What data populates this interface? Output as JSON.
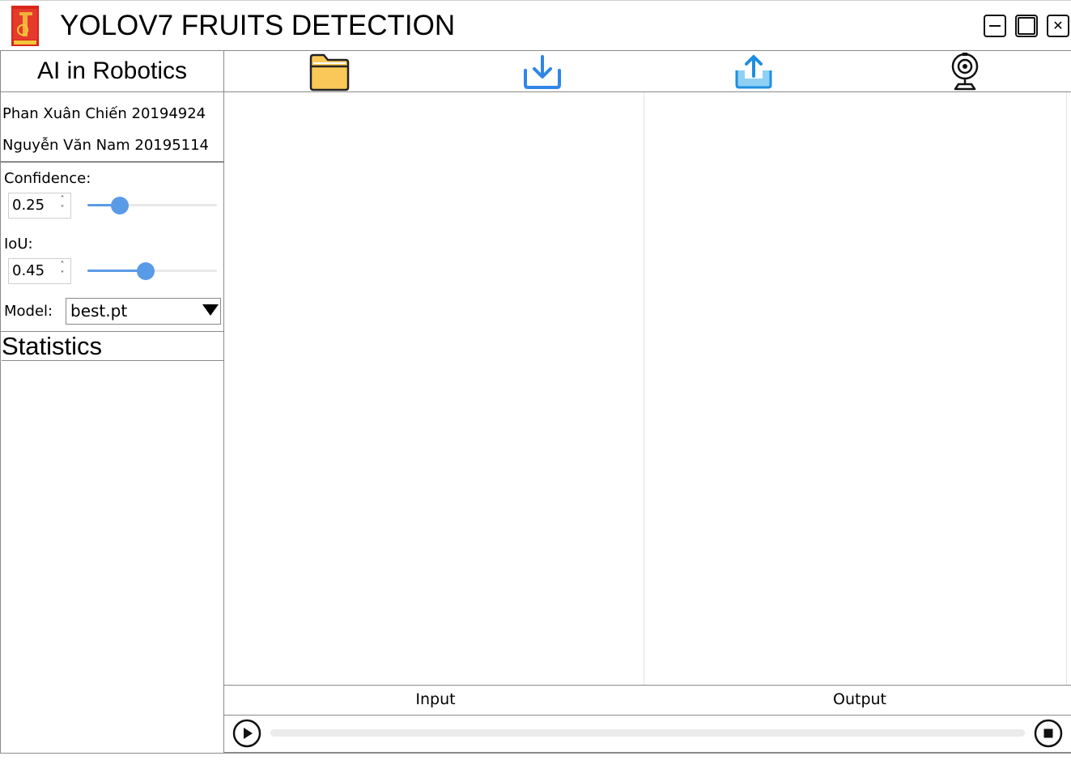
{
  "window": {
    "title": "YOLOV7 FRUITS DETECTION",
    "controls": {
      "minimize": "minimize-icon",
      "maximize": "maximize-icon",
      "close": "close-icon"
    }
  },
  "sidebar": {
    "course_title": "AI in Robotics",
    "members": [
      "Phan Xuân Chiến 20194924",
      "Nguyễn Văn Nam 20195114"
    ],
    "confidence": {
      "label": "Confidence:",
      "value": "0.25",
      "fraction": 0.25
    },
    "iou": {
      "label": "IoU:",
      "value": "0.45",
      "fraction": 0.45
    },
    "model": {
      "label": "Model:",
      "selected": "best.pt"
    },
    "statistics_title": "Statistics"
  },
  "toolbar": {
    "items": [
      "folder-icon",
      "download-icon",
      "upload-icon",
      "webcam-icon"
    ]
  },
  "panels": {
    "input_label": "Input",
    "output_label": "Output"
  },
  "player": {
    "play_icon": "play-icon",
    "stop_icon": "stop-icon",
    "progress": 0
  },
  "colors": {
    "accent_blue": "#5a9be8",
    "folder_yellow": "#f9c858",
    "border": "#8a8a8a"
  }
}
